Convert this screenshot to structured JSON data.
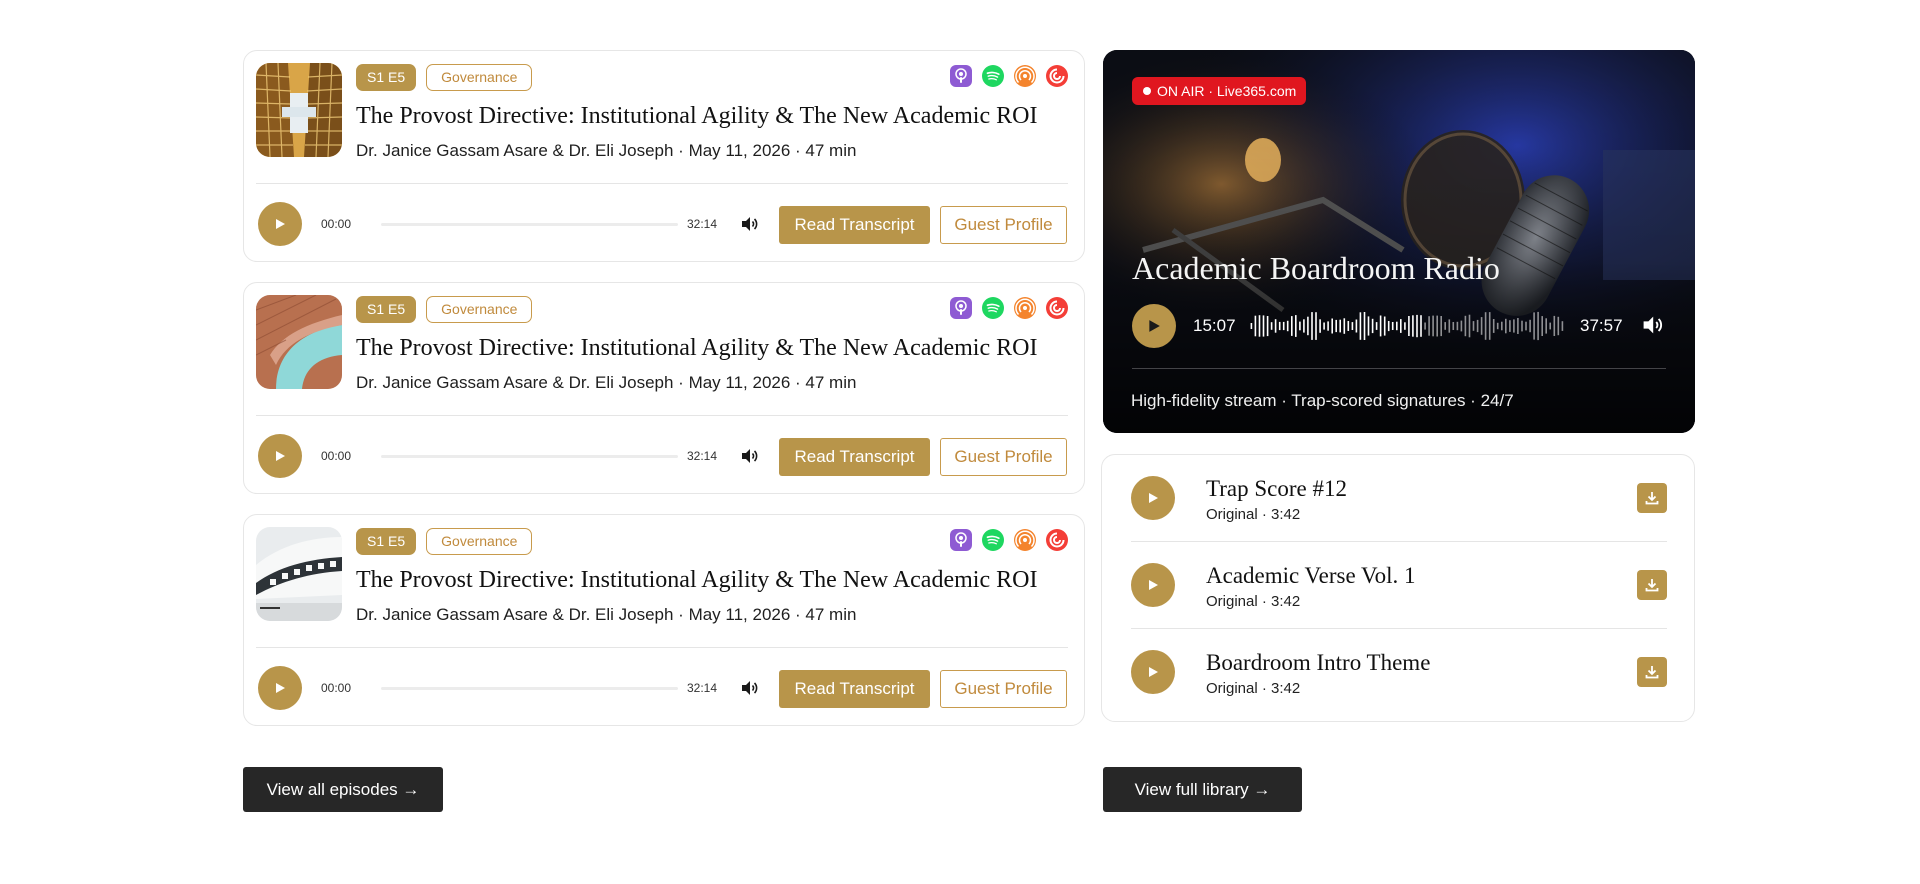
{
  "colors": {
    "accent": "#b8954a",
    "accent_outline": "#c89b4d",
    "on_air": "#e0161f",
    "dark_button": "#272727"
  },
  "episodes": [
    {
      "badge": "S1 E5",
      "category": "Governance",
      "title": "The Provost Directive: Institutional Agility & The New Academic ROI",
      "meta": "Dr. Janice Gassam Asare & Dr. Eli Joseph · May 11, 2026 · 47 min",
      "time_start": "00:00",
      "time_end": "32:14",
      "progress": 0,
      "transcript_label": "Read Transcript",
      "guest_label": "Guest Profile",
      "thumb": "glass-towers"
    },
    {
      "badge": "S1 E5",
      "category": "Governance",
      "title": "The Provost Directive: Institutional Agility & The New Academic ROI",
      "meta": "Dr. Janice Gassam Asare & Dr. Eli Joseph · May 11, 2026 · 47 min",
      "time_start": "00:00",
      "time_end": "32:14",
      "progress": 0,
      "transcript_label": "Read Transcript",
      "guest_label": "Guest Profile",
      "thumb": "curved-facade"
    },
    {
      "badge": "S1 E5",
      "category": "Governance",
      "title": "The Provost Directive: Institutional Agility & The New Academic ROI",
      "meta": "Dr. Janice Gassam Asare & Dr. Eli Joseph · May 11, 2026 · 47 min",
      "time_start": "00:00",
      "time_end": "32:14",
      "progress": 0,
      "transcript_label": "Read Transcript",
      "guest_label": "Guest Profile",
      "thumb": "white-building"
    }
  ],
  "platform_icons": [
    "apple-podcasts-icon",
    "spotify-icon",
    "podcast-addict-icon",
    "pocket-casts-icon"
  ],
  "view_all_episodes": "View all episodes →",
  "radio": {
    "on_air": "ON AIR · Live365.com",
    "title": "Academic Boardroom Radio",
    "time_elapsed": "15:07",
    "time_total": "37:57",
    "subtitle": "High-fidelity stream · Trap-scored signatures · 24/7"
  },
  "library": {
    "tracks": [
      {
        "title": "Trap Score #12",
        "meta": "Original · 3:42"
      },
      {
        "title": "Academic Verse Vol. 1",
        "meta": "Original · 3:42"
      },
      {
        "title": "Boardroom Intro Theme",
        "meta": "Original · 3:42"
      }
    ],
    "view_full": "View full library →"
  }
}
